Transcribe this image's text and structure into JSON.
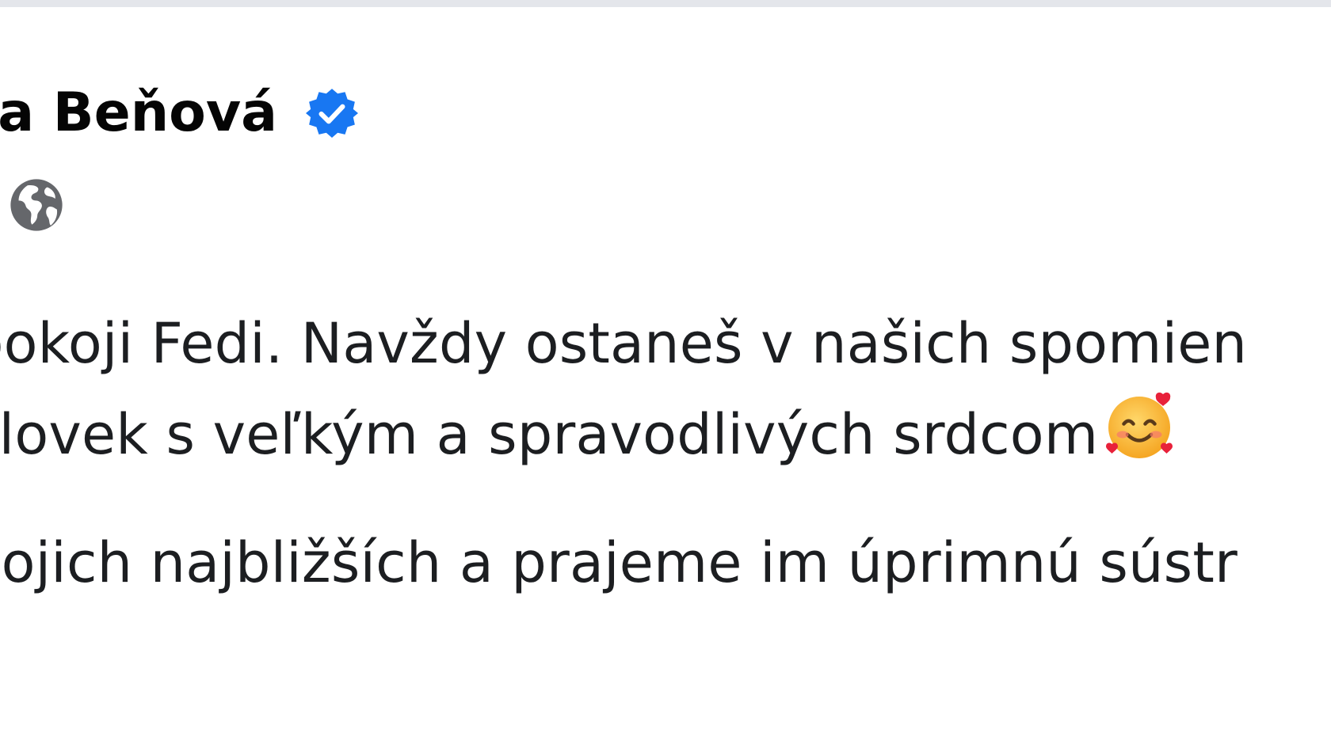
{
  "post": {
    "author_name": "ka Beňová",
    "verified_icon": "verified-badge-icon",
    "audience_icon": "globe-icon",
    "body_line_1": "pokoji Fedi. Navždy ostaneš v našich spomien",
    "body_line_2": "človek s veľkým a spravodlivých srdcom",
    "body_line_2_emoji": "smiling-face-with-hearts-emoji",
    "body_line_3": "vojich najbližších a prajeme im úprimnú sústr"
  },
  "colors": {
    "verified_blue": "#1877f2",
    "text": "#050505",
    "secondary_text": "#65676b",
    "top_band": "#e4e6eb"
  }
}
